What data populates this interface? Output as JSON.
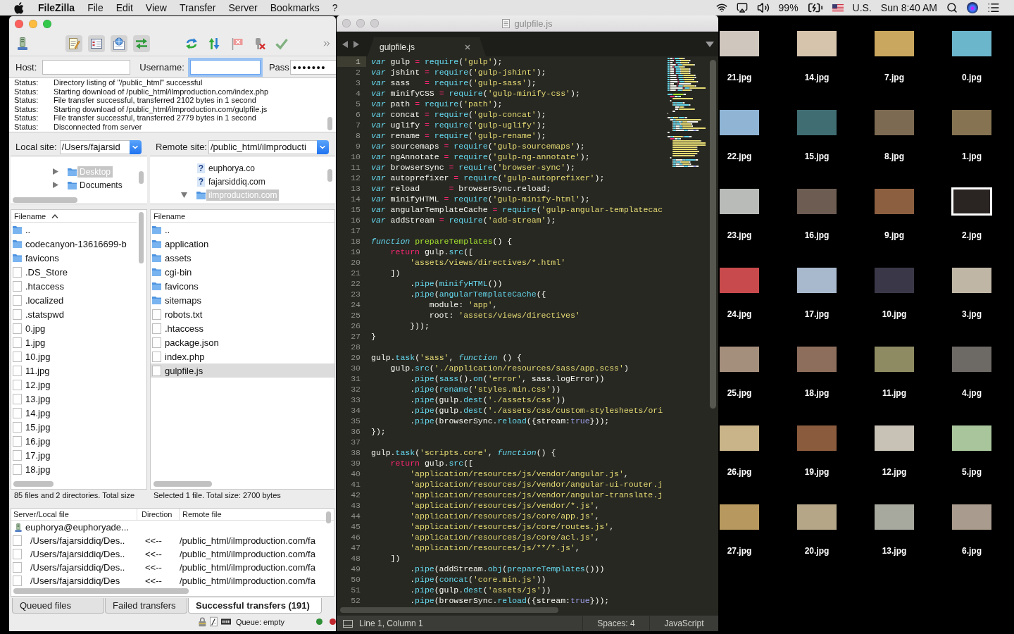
{
  "menubar": {
    "app": "FileZilla",
    "menus": [
      "File",
      "Edit",
      "View",
      "Transfer",
      "Server",
      "Bookmarks",
      "?"
    ],
    "battery": "99%",
    "input_source": "U.S.",
    "clock": "Sun 8:40 AM"
  },
  "filezilla": {
    "toolbar": [
      {
        "pressed": false
      },
      {
        "pressed": true
      },
      {
        "pressed": true
      },
      {
        "pressed": true
      },
      {
        "pressed": true
      },
      {
        "pressed": false
      },
      {
        "pressed": false
      },
      {
        "pressed": false
      },
      {
        "pressed": false
      },
      {
        "pressed": false
      }
    ],
    "quickconnect": [
      {
        "label": "Host:",
        "focused": false
      },
      {
        "label": "Username:",
        "focused": true
      },
      {
        "label": "Pass",
        "value": "•••••••",
        "focused": false
      }
    ],
    "log": [
      {
        "label": "Status:",
        "message": "Directory listing of \"/public_html\" successful"
      },
      {
        "label": "Status:",
        "message": "Starting download of /public_html/ilmproduction.com/index.php"
      },
      {
        "label": "Status:",
        "message": "File transfer successful, transferred 2102 bytes in 1 second"
      },
      {
        "label": "Status:",
        "message": "Starting download of /public_html/ilmproduction.com/gulpfile.js"
      },
      {
        "label": "Status:",
        "message": "File transfer successful, transferred 2779 bytes in 1 second"
      },
      {
        "label": "Status:",
        "message": "Disconnected from server"
      }
    ],
    "local": {
      "label": "Local site:",
      "path": "/Users/fajarsid",
      "tree": [
        {
          "kind": "folder",
          "label": "Desktop",
          "selected": true,
          "expanded": false
        },
        {
          "kind": "folder",
          "label": "Documents",
          "selected": false,
          "expanded": false
        }
      ],
      "columns": [
        {
          "label": "Filename",
          "sorted": true
        }
      ],
      "files": [
        {
          "kind": "folder",
          "name": "..",
          "selected": false
        },
        {
          "kind": "folder",
          "name": "codecanyon-13616699-b",
          "selected": false
        },
        {
          "kind": "folder",
          "name": "favicons",
          "selected": false
        },
        {
          "kind": "file",
          "name": ".DS_Store",
          "selected": false
        },
        {
          "kind": "file",
          "name": ".htaccess",
          "selected": false
        },
        {
          "kind": "file",
          "name": ".localized",
          "selected": false
        },
        {
          "kind": "file",
          "name": ".statspwd",
          "selected": false
        },
        {
          "kind": "file",
          "name": "0.jpg",
          "selected": false
        },
        {
          "kind": "file",
          "name": "1.jpg",
          "selected": false
        },
        {
          "kind": "file",
          "name": "10.jpg",
          "selected": false
        },
        {
          "kind": "file",
          "name": "11.jpg",
          "selected": false
        },
        {
          "kind": "file",
          "name": "12.jpg",
          "selected": false
        },
        {
          "kind": "file",
          "name": "13.jpg",
          "selected": false
        },
        {
          "kind": "file",
          "name": "14.jpg",
          "selected": false
        },
        {
          "kind": "file",
          "name": "15.jpg",
          "selected": false
        },
        {
          "kind": "file",
          "name": "16.jpg",
          "selected": false
        },
        {
          "kind": "file",
          "name": "17.jpg",
          "selected": false
        },
        {
          "kind": "file",
          "name": "18.jpg",
          "selected": false
        }
      ],
      "summary": "85 files and 2 directories. Total size"
    },
    "remote": {
      "label": "Remote site:",
      "path": "/public_html/ilmproducti",
      "tree": [
        {
          "kind": "unknown",
          "marker": "?",
          "label": "euphorya.co",
          "selected": false
        },
        {
          "kind": "unknown",
          "marker": "?",
          "label": "fajarsiddiq.com",
          "selected": false
        },
        {
          "kind": "folder",
          "label": "ilmproduction.com",
          "selected": true,
          "expanded": true
        }
      ],
      "columns": [
        {
          "label": "Filename",
          "sorted": false
        }
      ],
      "files": [
        {
          "kind": "folder",
          "name": "..",
          "selected": false
        },
        {
          "kind": "folder",
          "name": "application",
          "selected": false
        },
        {
          "kind": "folder",
          "name": "assets",
          "selected": false
        },
        {
          "kind": "folder",
          "name": "cgi-bin",
          "selected": false
        },
        {
          "kind": "folder",
          "name": "favicons",
          "selected": false
        },
        {
          "kind": "folder",
          "name": "sitemaps",
          "selected": false
        },
        {
          "kind": "file",
          "name": "robots.txt",
          "selected": false
        },
        {
          "kind": "file",
          "name": ".htaccess",
          "selected": false
        },
        {
          "kind": "file",
          "name": "package.json",
          "selected": false
        },
        {
          "kind": "file",
          "name": "index.php",
          "selected": false
        },
        {
          "kind": "file",
          "name": "gulpfile.js",
          "selected": true
        }
      ],
      "summary": "Selected 1 file. Total size: 2700 bytes"
    },
    "queue": {
      "columns": [
        "Server/Local file",
        "Direction",
        "Remote file"
      ],
      "server": "euphorya@euphoryade...",
      "rows": [
        {
          "local": "/Users/fajarsiddiq/Des..",
          "direction": "<<--",
          "remote": "/public_html/ilmproduction.com/fa"
        },
        {
          "local": "/Users/fajarsiddiq/Des..",
          "direction": "<<--",
          "remote": "/public_html/ilmproduction.com/fa"
        },
        {
          "local": "/Users/fajarsiddiq/Des..",
          "direction": "<<--",
          "remote": "/public_html/ilmproduction.com/fa"
        },
        {
          "local": "/Users/fajarsiddiq/Des",
          "direction": "<<--",
          "remote": "/public_html/ilmproduction.com/fa"
        }
      ]
    },
    "tabs": [
      {
        "label": "Queued files",
        "selected": false
      },
      {
        "label": "Failed transfers",
        "selected": false
      },
      {
        "label": "Successful transfers (191)",
        "selected": true
      }
    ],
    "status": {
      "queue": "Queue: empty",
      "lights": [
        {
          "color": "#2e8f35"
        },
        {
          "color": "#c0272d"
        }
      ]
    }
  },
  "editor": {
    "title": "gulpfile.js",
    "tab": "gulpfile.js",
    "lines": [
      {
        "number": "1",
        "current": true,
        "tokens": [
          {
            "kind": "storage",
            "text": "var"
          },
          {
            "kind": "plain",
            "text": " gulp "
          },
          {
            "kind": "operator",
            "text": "= "
          },
          {
            "kind": "support",
            "text": "require"
          },
          {
            "kind": "plain",
            "text": "("
          },
          {
            "kind": "string",
            "text": "'gulp'"
          },
          {
            "kind": "plain",
            "text": ");"
          }
        ]
      },
      {
        "number": "2",
        "current": false,
        "tokens": [
          {
            "kind": "storage",
            "text": "var"
          },
          {
            "kind": "plain",
            "text": " jshint "
          },
          {
            "kind": "operator",
            "text": "= "
          },
          {
            "kind": "support",
            "text": "require"
          },
          {
            "kind": "plain",
            "text": "("
          },
          {
            "kind": "string",
            "text": "'gulp-jshint'"
          },
          {
            "kind": "plain",
            "text": ");"
          }
        ]
      },
      {
        "number": "3",
        "current": false,
        "tokens": [
          {
            "kind": "storage",
            "text": "var"
          },
          {
            "kind": "plain",
            "text": " sass   "
          },
          {
            "kind": "operator",
            "text": "= "
          },
          {
            "kind": "support",
            "text": "require"
          },
          {
            "kind": "plain",
            "text": "("
          },
          {
            "kind": "string",
            "text": "'gulp-sass'"
          },
          {
            "kind": "plain",
            "text": ");"
          }
        ]
      },
      {
        "number": "4",
        "current": false,
        "tokens": [
          {
            "kind": "storage",
            "text": "var"
          },
          {
            "kind": "plain",
            "text": " minifyCSS "
          },
          {
            "kind": "operator",
            "text": "= "
          },
          {
            "kind": "support",
            "text": "require"
          },
          {
            "kind": "plain",
            "text": "("
          },
          {
            "kind": "string",
            "text": "'gulp-minify-css'"
          },
          {
            "kind": "plain",
            "text": ");"
          }
        ]
      },
      {
        "number": "5",
        "current": false,
        "tokens": [
          {
            "kind": "storage",
            "text": "var"
          },
          {
            "kind": "plain",
            "text": " path "
          },
          {
            "kind": "operator",
            "text": "= "
          },
          {
            "kind": "support",
            "text": "require"
          },
          {
            "kind": "plain",
            "text": "("
          },
          {
            "kind": "string",
            "text": "'path'"
          },
          {
            "kind": "plain",
            "text": ");"
          }
        ]
      },
      {
        "number": "6",
        "current": false,
        "tokens": [
          {
            "kind": "storage",
            "text": "var"
          },
          {
            "kind": "plain",
            "text": " concat "
          },
          {
            "kind": "operator",
            "text": "= "
          },
          {
            "kind": "support",
            "text": "require"
          },
          {
            "kind": "plain",
            "text": "("
          },
          {
            "kind": "string",
            "text": "'gulp-concat'"
          },
          {
            "kind": "plain",
            "text": ");"
          }
        ]
      },
      {
        "number": "7",
        "current": false,
        "tokens": [
          {
            "kind": "storage",
            "text": "var"
          },
          {
            "kind": "plain",
            "text": " uglify "
          },
          {
            "kind": "operator",
            "text": "= "
          },
          {
            "kind": "support",
            "text": "require"
          },
          {
            "kind": "plain",
            "text": "("
          },
          {
            "kind": "string",
            "text": "'gulp-uglify'"
          },
          {
            "kind": "plain",
            "text": ");"
          }
        ]
      },
      {
        "number": "8",
        "current": false,
        "tokens": [
          {
            "kind": "storage",
            "text": "var"
          },
          {
            "kind": "plain",
            "text": " rename "
          },
          {
            "kind": "operator",
            "text": "= "
          },
          {
            "kind": "support",
            "text": "require"
          },
          {
            "kind": "plain",
            "text": "("
          },
          {
            "kind": "string",
            "text": "'gulp-rename'"
          },
          {
            "kind": "plain",
            "text": ");"
          }
        ]
      },
      {
        "number": "9",
        "current": false,
        "tokens": [
          {
            "kind": "storage",
            "text": "var"
          },
          {
            "kind": "plain",
            "text": " sourcemaps "
          },
          {
            "kind": "operator",
            "text": "= "
          },
          {
            "kind": "support",
            "text": "require"
          },
          {
            "kind": "plain",
            "text": "("
          },
          {
            "kind": "string",
            "text": "'gulp-sourcemaps'"
          },
          {
            "kind": "plain",
            "text": ");"
          }
        ]
      },
      {
        "number": "10",
        "current": false,
        "tokens": [
          {
            "kind": "storage",
            "text": "var"
          },
          {
            "kind": "plain",
            "text": " ngAnnotate "
          },
          {
            "kind": "operator",
            "text": "= "
          },
          {
            "kind": "support",
            "text": "require"
          },
          {
            "kind": "plain",
            "text": "("
          },
          {
            "kind": "string",
            "text": "'gulp-ng-annotate'"
          },
          {
            "kind": "plain",
            "text": ");"
          }
        ]
      },
      {
        "number": "11",
        "current": false,
        "tokens": [
          {
            "kind": "storage",
            "text": "var"
          },
          {
            "kind": "plain",
            "text": " browserSync "
          },
          {
            "kind": "operator",
            "text": "= "
          },
          {
            "kind": "support",
            "text": "require"
          },
          {
            "kind": "plain",
            "text": "("
          },
          {
            "kind": "string",
            "text": "'browser-sync'"
          },
          {
            "kind": "plain",
            "text": ");"
          }
        ]
      },
      {
        "number": "12",
        "current": false,
        "tokens": [
          {
            "kind": "storage",
            "text": "var"
          },
          {
            "kind": "plain",
            "text": " autoprefixer "
          },
          {
            "kind": "operator",
            "text": "= "
          },
          {
            "kind": "support",
            "text": "require"
          },
          {
            "kind": "plain",
            "text": "("
          },
          {
            "kind": "string",
            "text": "'gulp-autoprefixer'"
          },
          {
            "kind": "plain",
            "text": ");"
          }
        ]
      },
      {
        "number": "13",
        "current": false,
        "tokens": [
          {
            "kind": "storage",
            "text": "var"
          },
          {
            "kind": "plain",
            "text": " reload      "
          },
          {
            "kind": "operator",
            "text": "= "
          },
          {
            "kind": "plain",
            "text": "browserSync.reload;"
          }
        ]
      },
      {
        "number": "14",
        "current": false,
        "tokens": [
          {
            "kind": "storage",
            "text": "var"
          },
          {
            "kind": "plain",
            "text": " minifyHTML "
          },
          {
            "kind": "operator",
            "text": "= "
          },
          {
            "kind": "support",
            "text": "require"
          },
          {
            "kind": "plain",
            "text": "("
          },
          {
            "kind": "string",
            "text": "'gulp-minify-html'"
          },
          {
            "kind": "plain",
            "text": ");"
          }
        ]
      },
      {
        "number": "15",
        "current": false,
        "tokens": [
          {
            "kind": "storage",
            "text": "var"
          },
          {
            "kind": "plain",
            "text": " angularTemplateCache "
          },
          {
            "kind": "operator",
            "text": "= "
          },
          {
            "kind": "support",
            "text": "require"
          },
          {
            "kind": "plain",
            "text": "("
          },
          {
            "kind": "string",
            "text": "'gulp-angular-templatecac"
          }
        ]
      },
      {
        "number": "16",
        "current": false,
        "tokens": [
          {
            "kind": "storage",
            "text": "var"
          },
          {
            "kind": "plain",
            "text": " addStream "
          },
          {
            "kind": "operator",
            "text": "= "
          },
          {
            "kind": "support",
            "text": "require"
          },
          {
            "kind": "plain",
            "text": "("
          },
          {
            "kind": "string",
            "text": "'add-stream'"
          },
          {
            "kind": "plain",
            "text": ");"
          }
        ]
      },
      {
        "number": "17",
        "current": false
      },
      {
        "number": "18",
        "current": false,
        "tokens": [
          {
            "kind": "storage",
            "text": "function "
          },
          {
            "kind": "entity",
            "text": "prepareTemplates"
          },
          {
            "kind": "plain",
            "text": "() {"
          }
        ]
      },
      {
        "number": "19",
        "current": false,
        "tokens": [
          {
            "kind": "keyword",
            "text": "    return"
          },
          {
            "kind": "plain",
            "text": " gulp."
          },
          {
            "kind": "support",
            "text": "src"
          },
          {
            "kind": "plain",
            "text": "(["
          }
        ]
      },
      {
        "number": "20",
        "current": false,
        "tokens": [
          {
            "kind": "string",
            "text": "        'assets/views/directives/*.html'"
          }
        ]
      },
      {
        "number": "21",
        "current": false,
        "tokens": [
          {
            "kind": "plain",
            "text": "    ])"
          }
        ]
      },
      {
        "number": "22",
        "current": false,
        "tokens": [
          {
            "kind": "plain",
            "text": "        ."
          },
          {
            "kind": "support",
            "text": "pipe"
          },
          {
            "kind": "plain",
            "text": "("
          },
          {
            "kind": "support",
            "text": "minifyHTML"
          },
          {
            "kind": "plain",
            "text": "())"
          }
        ]
      },
      {
        "number": "23",
        "current": false,
        "tokens": [
          {
            "kind": "plain",
            "text": "        ."
          },
          {
            "kind": "support",
            "text": "pipe"
          },
          {
            "kind": "plain",
            "text": "("
          },
          {
            "kind": "support",
            "text": "angularTemplateCache"
          },
          {
            "kind": "plain",
            "text": "({"
          }
        ]
      },
      {
        "number": "24",
        "current": false,
        "tokens": [
          {
            "kind": "plain",
            "text": "            module: "
          },
          {
            "kind": "string",
            "text": "'app'"
          },
          {
            "kind": "plain",
            "text": ","
          }
        ]
      },
      {
        "number": "25",
        "current": false,
        "tokens": [
          {
            "kind": "plain",
            "text": "            root: "
          },
          {
            "kind": "string",
            "text": "'assets/views/directives'"
          }
        ]
      },
      {
        "number": "26",
        "current": false,
        "tokens": [
          {
            "kind": "plain",
            "text": "        }));"
          }
        ]
      },
      {
        "number": "27",
        "current": false,
        "tokens": [
          {
            "kind": "plain",
            "text": "}"
          }
        ]
      },
      {
        "number": "28",
        "current": false
      },
      {
        "number": "29",
        "current": false,
        "tokens": [
          {
            "kind": "plain",
            "text": "gulp."
          },
          {
            "kind": "support",
            "text": "task"
          },
          {
            "kind": "plain",
            "text": "("
          },
          {
            "kind": "string",
            "text": "'sass'"
          },
          {
            "kind": "plain",
            "text": ", "
          },
          {
            "kind": "storage",
            "text": "function"
          },
          {
            "kind": "plain",
            "text": " () {"
          }
        ]
      },
      {
        "number": "30",
        "current": false,
        "tokens": [
          {
            "kind": "plain",
            "text": "    gulp."
          },
          {
            "kind": "support",
            "text": "src"
          },
          {
            "kind": "plain",
            "text": "("
          },
          {
            "kind": "string",
            "text": "'./application/resources/sass/app.scss'"
          },
          {
            "kind": "plain",
            "text": ")"
          }
        ]
      },
      {
        "number": "31",
        "current": false,
        "tokens": [
          {
            "kind": "plain",
            "text": "        ."
          },
          {
            "kind": "support",
            "text": "pipe"
          },
          {
            "kind": "plain",
            "text": "("
          },
          {
            "kind": "support",
            "text": "sass"
          },
          {
            "kind": "plain",
            "text": "()."
          },
          {
            "kind": "support",
            "text": "on"
          },
          {
            "kind": "plain",
            "text": "("
          },
          {
            "kind": "string",
            "text": "'error'"
          },
          {
            "kind": "plain",
            "text": ", sass.logError))"
          }
        ]
      },
      {
        "number": "32",
        "current": false,
        "tokens": [
          {
            "kind": "plain",
            "text": "        ."
          },
          {
            "kind": "support",
            "text": "pipe"
          },
          {
            "kind": "plain",
            "text": "("
          },
          {
            "kind": "support",
            "text": "rename"
          },
          {
            "kind": "plain",
            "text": "("
          },
          {
            "kind": "string",
            "text": "'styles.min.css'"
          },
          {
            "kind": "plain",
            "text": "))"
          }
        ]
      },
      {
        "number": "33",
        "current": false,
        "tokens": [
          {
            "kind": "plain",
            "text": "        ."
          },
          {
            "kind": "support",
            "text": "pipe"
          },
          {
            "kind": "plain",
            "text": "(gulp."
          },
          {
            "kind": "support",
            "text": "dest"
          },
          {
            "kind": "plain",
            "text": "("
          },
          {
            "kind": "string",
            "text": "'./assets/css'"
          },
          {
            "kind": "plain",
            "text": "))"
          }
        ]
      },
      {
        "number": "34",
        "current": false,
        "tokens": [
          {
            "kind": "plain",
            "text": "        ."
          },
          {
            "kind": "support",
            "text": "pipe"
          },
          {
            "kind": "plain",
            "text": "(gulp."
          },
          {
            "kind": "support",
            "text": "dest"
          },
          {
            "kind": "plain",
            "text": "("
          },
          {
            "kind": "string",
            "text": "'./assets/css/custom-stylesheets/ori"
          }
        ]
      },
      {
        "number": "35",
        "current": false,
        "tokens": [
          {
            "kind": "plain",
            "text": "        ."
          },
          {
            "kind": "support",
            "text": "pipe"
          },
          {
            "kind": "plain",
            "text": "(browserSync."
          },
          {
            "kind": "support",
            "text": "reload"
          },
          {
            "kind": "plain",
            "text": "({stream:"
          },
          {
            "kind": "constant",
            "text": "true"
          },
          {
            "kind": "plain",
            "text": "}));"
          }
        ]
      },
      {
        "number": "36",
        "current": false,
        "tokens": [
          {
            "kind": "plain",
            "text": "});"
          }
        ]
      },
      {
        "number": "37",
        "current": false
      },
      {
        "number": "38",
        "current": false,
        "tokens": [
          {
            "kind": "plain",
            "text": "gulp."
          },
          {
            "kind": "support",
            "text": "task"
          },
          {
            "kind": "plain",
            "text": "("
          },
          {
            "kind": "string",
            "text": "'scripts.core'"
          },
          {
            "kind": "plain",
            "text": ", "
          },
          {
            "kind": "storage",
            "text": "function"
          },
          {
            "kind": "plain",
            "text": "() {"
          }
        ]
      },
      {
        "number": "39",
        "current": false,
        "tokens": [
          {
            "kind": "keyword",
            "text": "    return"
          },
          {
            "kind": "plain",
            "text": " gulp."
          },
          {
            "kind": "support",
            "text": "src"
          },
          {
            "kind": "plain",
            "text": "(["
          }
        ]
      },
      {
        "number": "40",
        "current": false,
        "tokens": [
          {
            "kind": "string",
            "text": "        'application/resources/js/vendor/angular.js'"
          },
          {
            "kind": "plain",
            "text": ","
          }
        ]
      },
      {
        "number": "41",
        "current": false,
        "tokens": [
          {
            "kind": "string",
            "text": "        'application/resources/js/vendor/angular-ui-router.j"
          }
        ]
      },
      {
        "number": "42",
        "current": false,
        "tokens": [
          {
            "kind": "string",
            "text": "        'application/resources/js/vendor/angular-translate.j"
          }
        ]
      },
      {
        "number": "43",
        "current": false,
        "tokens": [
          {
            "kind": "string",
            "text": "        'application/resources/js/vendor/*.js'"
          },
          {
            "kind": "plain",
            "text": ","
          }
        ]
      },
      {
        "number": "44",
        "current": false,
        "tokens": [
          {
            "kind": "string",
            "text": "        'application/resources/js/core/app.js'"
          },
          {
            "kind": "plain",
            "text": ","
          }
        ]
      },
      {
        "number": "45",
        "current": false,
        "tokens": [
          {
            "kind": "string",
            "text": "        'application/resources/js/core/routes.js'"
          },
          {
            "kind": "plain",
            "text": ","
          }
        ]
      },
      {
        "number": "46",
        "current": false,
        "tokens": [
          {
            "kind": "string",
            "text": "        'application/resources/js/core/acl.js'"
          },
          {
            "kind": "plain",
            "text": ","
          }
        ]
      },
      {
        "number": "47",
        "current": false,
        "tokens": [
          {
            "kind": "string",
            "text": "        'application/resources/js/**/*.js'"
          },
          {
            "kind": "plain",
            "text": ","
          }
        ]
      },
      {
        "number": "48",
        "current": false,
        "tokens": [
          {
            "kind": "plain",
            "text": "    ])"
          }
        ]
      },
      {
        "number": "49",
        "current": false,
        "tokens": [
          {
            "kind": "plain",
            "text": "        ."
          },
          {
            "kind": "support",
            "text": "pipe"
          },
          {
            "kind": "plain",
            "text": "(addStream."
          },
          {
            "kind": "support",
            "text": "obj"
          },
          {
            "kind": "plain",
            "text": "("
          },
          {
            "kind": "support",
            "text": "prepareTemplates"
          },
          {
            "kind": "plain",
            "text": "()))"
          }
        ]
      },
      {
        "number": "50",
        "current": false,
        "tokens": [
          {
            "kind": "plain",
            "text": "        ."
          },
          {
            "kind": "support",
            "text": "pipe"
          },
          {
            "kind": "plain",
            "text": "("
          },
          {
            "kind": "support",
            "text": "concat"
          },
          {
            "kind": "plain",
            "text": "("
          },
          {
            "kind": "string",
            "text": "'core.min.js'"
          },
          {
            "kind": "plain",
            "text": "))"
          }
        ]
      },
      {
        "number": "51",
        "current": false,
        "tokens": [
          {
            "kind": "plain",
            "text": "        ."
          },
          {
            "kind": "support",
            "text": "pipe"
          },
          {
            "kind": "plain",
            "text": "(gulp."
          },
          {
            "kind": "support",
            "text": "dest"
          },
          {
            "kind": "plain",
            "text": "("
          },
          {
            "kind": "string",
            "text": "'assets/js'"
          },
          {
            "kind": "plain",
            "text": "))"
          }
        ]
      },
      {
        "number": "52",
        "current": false,
        "tokens": [
          {
            "kind": "plain",
            "text": "        ."
          },
          {
            "kind": "support",
            "text": "pipe"
          },
          {
            "kind": "plain",
            "text": "(browserSync."
          },
          {
            "kind": "support",
            "text": "reload"
          },
          {
            "kind": "plain",
            "text": "({stream:"
          },
          {
            "kind": "constant",
            "text": "true"
          },
          {
            "kind": "plain",
            "text": "}));"
          }
        ]
      }
    ],
    "status": {
      "position": "Line 1, Column 1",
      "indent": "Spaces: 4",
      "syntax": "JavaScript"
    }
  },
  "desktop": {
    "files": [
      {
        "name": "21.jpg",
        "selected": false
      },
      {
        "name": "14.jpg",
        "selected": false
      },
      {
        "name": "7.jpg",
        "selected": false
      },
      {
        "name": "0.jpg",
        "selected": false
      },
      {
        "name": "22.jpg",
        "selected": false
      },
      {
        "name": "15.jpg",
        "selected": false
      },
      {
        "name": "8.jpg",
        "selected": false
      },
      {
        "name": "1.jpg",
        "selected": false
      },
      {
        "name": "23.jpg",
        "selected": false
      },
      {
        "name": "16.jpg",
        "selected": false
      },
      {
        "name": "9.jpg",
        "selected": false
      },
      {
        "name": "2.jpg",
        "selected": true
      },
      {
        "name": "24.jpg",
        "selected": false
      },
      {
        "name": "17.jpg",
        "selected": false
      },
      {
        "name": "10.jpg",
        "selected": false
      },
      {
        "name": "3.jpg",
        "selected": false
      },
      {
        "name": "25.jpg",
        "selected": false
      },
      {
        "name": "18.jpg",
        "selected": false
      },
      {
        "name": "11.jpg",
        "selected": false
      },
      {
        "name": "4.jpg",
        "selected": false
      },
      {
        "name": "26.jpg",
        "selected": false
      },
      {
        "name": "19.jpg",
        "selected": false
      },
      {
        "name": "12.jpg",
        "selected": false
      },
      {
        "name": "5.jpg",
        "selected": false
      },
      {
        "name": "27.jpg",
        "selected": false
      },
      {
        "name": "20.jpg",
        "selected": false
      },
      {
        "name": "13.jpg",
        "selected": false
      },
      {
        "name": "6.jpg",
        "selected": false
      }
    ]
  }
}
